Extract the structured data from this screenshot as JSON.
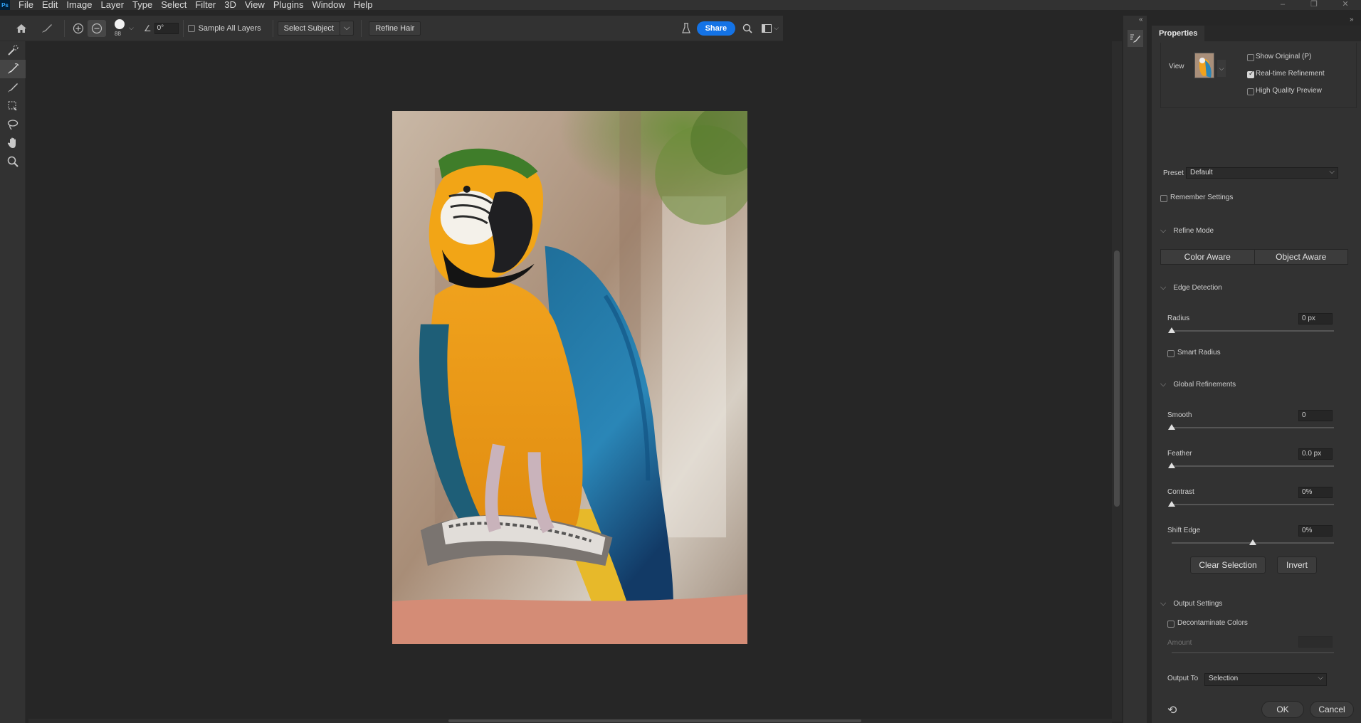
{
  "app": {
    "logo": "Ps",
    "menu": [
      "File",
      "Edit",
      "Image",
      "Layer",
      "Type",
      "Select",
      "Filter",
      "3D",
      "View",
      "Plugins",
      "Window",
      "Help"
    ],
    "window_controls": [
      "–",
      "❐",
      "✕"
    ]
  },
  "options": {
    "brush_size": "88",
    "angle": "0°",
    "sample_all_layers": "Sample All Layers",
    "select_subject": "Select Subject",
    "refine_hair": "Refine Hair",
    "share": "Share"
  },
  "properties": {
    "tab": "Properties",
    "view_label": "View",
    "show_original": "Show Original (P)",
    "realtime_refinement": "Real-time Refinement",
    "high_quality_preview": "High Quality Preview",
    "preset_label": "Preset",
    "preset_value": "Default",
    "remember_settings": "Remember Settings",
    "refine_mode": {
      "title": "Refine Mode",
      "color_aware": "Color Aware",
      "object_aware": "Object Aware"
    },
    "edge_detection": {
      "title": "Edge Detection",
      "radius_label": "Radius",
      "radius_value": "0 px",
      "smart_radius": "Smart Radius"
    },
    "global_refinements": {
      "title": "Global Refinements",
      "smooth_label": "Smooth",
      "smooth_value": "0",
      "feather_label": "Feather",
      "feather_value": "0.0 px",
      "contrast_label": "Contrast",
      "contrast_value": "0%",
      "shift_edge_label": "Shift Edge",
      "shift_edge_value": "0%"
    },
    "clear_selection": "Clear Selection",
    "invert": "Invert",
    "output_settings": {
      "title": "Output Settings",
      "decontaminate": "Decontaminate Colors",
      "amount_label": "Amount",
      "output_to_label": "Output To",
      "output_to_value": "Selection"
    },
    "ok": "OK",
    "cancel": "Cancel"
  },
  "colors": {
    "accent": "#1473e6",
    "panel_bg": "#323232",
    "canvas_bg": "#262626"
  }
}
